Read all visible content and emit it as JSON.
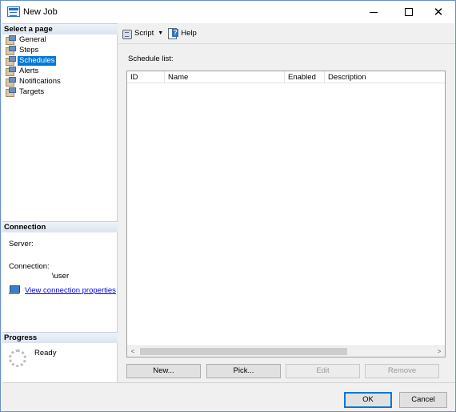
{
  "window": {
    "title": "New Job",
    "close_glyph": "✕"
  },
  "sidebar": {
    "select_page_header": "Select a page",
    "items": [
      {
        "label": "General",
        "selected": false
      },
      {
        "label": "Steps",
        "selected": false
      },
      {
        "label": "Schedules",
        "selected": true
      },
      {
        "label": "Alerts",
        "selected": false
      },
      {
        "label": "Notifications",
        "selected": false
      },
      {
        "label": "Targets",
        "selected": false
      }
    ],
    "connection_header": "Connection",
    "server_label": "Server:",
    "connection_label": "Connection:",
    "connection_value": "\\user",
    "view_properties_link": "View connection properties",
    "progress_header": "Progress",
    "progress_status": "Ready"
  },
  "toolbar": {
    "script_label": "Script",
    "help_label": "Help"
  },
  "main": {
    "schedule_list_label": "Schedule list:",
    "columns": [
      "ID",
      "Name",
      "Enabled",
      "Description"
    ],
    "rows": [],
    "buttons": {
      "new": "New...",
      "pick": "Pick...",
      "edit": "Edit",
      "remove": "Remove"
    }
  },
  "footer": {
    "ok": "OK",
    "cancel": "Cancel"
  },
  "colors": {
    "selection": "#0078d7",
    "link": "#0000ee"
  },
  "icons": {
    "app": "job-window-icon",
    "nav": "page-icon",
    "script": "script-icon",
    "help": "help-icon",
    "connection": "connection-properties-icon",
    "progress": "progress-spinner-icon"
  }
}
